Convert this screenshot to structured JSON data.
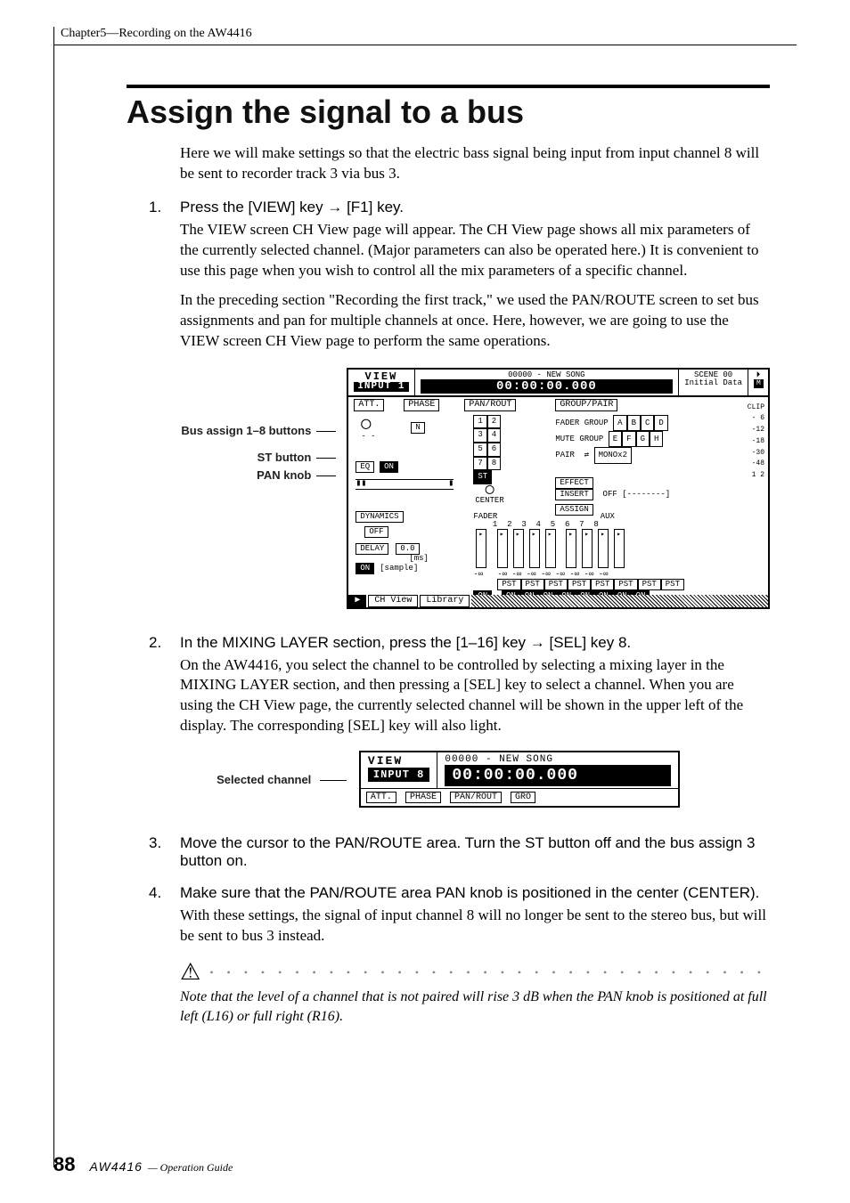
{
  "header": {
    "chapter": "Chapter5—Recording on the AW4416"
  },
  "title": "Assign the signal to a bus",
  "intro": "Here we will make settings so that the electric bass signal being input from input channel 8 will be sent to recorder track 3 via bus 3.",
  "steps": [
    {
      "num": "1.",
      "title_a": "Press the [VIEW] key ",
      "title_b": " [F1] key.",
      "paras": [
        "The VIEW screen CH View page will appear. The CH View page shows all mix parameters of the currently selected channel. (Major parameters can also be operated here.) It is convenient to use this page when you wish to control all the mix parameters of a specific channel.",
        "In the preceding section \"Recording the first track,\" we used the PAN/ROUTE screen to set bus assignments and pan for multiple channels at once. Here, however, we are going to use the VIEW screen CH View page to perform the same operations."
      ]
    },
    {
      "num": "2.",
      "title_a": "In the MIXING LAYER section, press the [1–16] key ",
      "title_b": " [SEL] key 8.",
      "paras": [
        "On the AW4416, you select the channel to be controlled by selecting a mixing layer in the MIXING LAYER section, and then pressing a [SEL] key to select a channel. When you are using the CH View page, the currently selected channel will be shown in the upper left of the display. The corresponding [SEL] key will also light."
      ]
    },
    {
      "num": "3.",
      "title_a": "Move the cursor to the PAN/ROUTE area. Turn the ST button off and the bus assign 3 button on.",
      "title_b": "",
      "paras": []
    },
    {
      "num": "4.",
      "title_a": "Make sure that the PAN/ROUTE area PAN knob is positioned in the center (CENTER).",
      "title_b": "",
      "paras": [
        "With these settings, the signal of input channel 8 will no longer be sent to the stereo bus, but will be sent to bus 3 instead."
      ]
    }
  ],
  "figure1": {
    "callouts": {
      "bus_assign": "Bus assign 1–8 buttons",
      "st_button": "ST button",
      "pan_knob": "PAN knob"
    },
    "lcd": {
      "view": "VIEW",
      "input": "INPUT 1",
      "song": "00000 - NEW SONG",
      "time": "00:00:00.000",
      "scene": "SCENE 00",
      "initial": "Initial Data",
      "att": "ATT.",
      "phase": "PHASE",
      "panrout": "PAN/ROUT",
      "grouppair": "GROUP/PAIR",
      "fader_group": "FADER GROUP",
      "mute_group": "MUTE GROUP",
      "pair": "PAIR",
      "mono": "MONOx2",
      "eq": "EQ",
      "on": "ON",
      "st": "ST",
      "center": "CENTER",
      "effect": "EFFECT",
      "insert": "INSERT",
      "off": "OFF",
      "assign": "ASSIGN",
      "dynamics": "DYNAMICS",
      "delay": "DELAY",
      "delay_val": "0.0",
      "delay_ms": "[ms]",
      "delay_sample": "[sample]",
      "fader": "FADER",
      "aux": "AUX",
      "pst": "PST",
      "tab_chview": "CH View",
      "tab_library": "Library",
      "scale": [
        "CLIP",
        "- 6",
        "-12",
        "-18",
        "-30",
        "-48"
      ],
      "meters": "1  2"
    }
  },
  "figure2": {
    "callout": "Selected channel",
    "lcd": {
      "view": "VIEW",
      "input": "INPUT 8",
      "song": "00000 - NEW SONG",
      "time": "00:00:00.000",
      "tags": [
        "ATT.",
        "PHASE",
        "PAN/ROUT",
        "GRO"
      ]
    }
  },
  "note": {
    "text": "Note that the level of a channel that is not paired will rise 3 dB when the PAN knob is positioned at full left (L16) or full right (R16)."
  },
  "footer": {
    "page": "88",
    "model": "AW4416",
    "guide": "— Operation Guide"
  }
}
